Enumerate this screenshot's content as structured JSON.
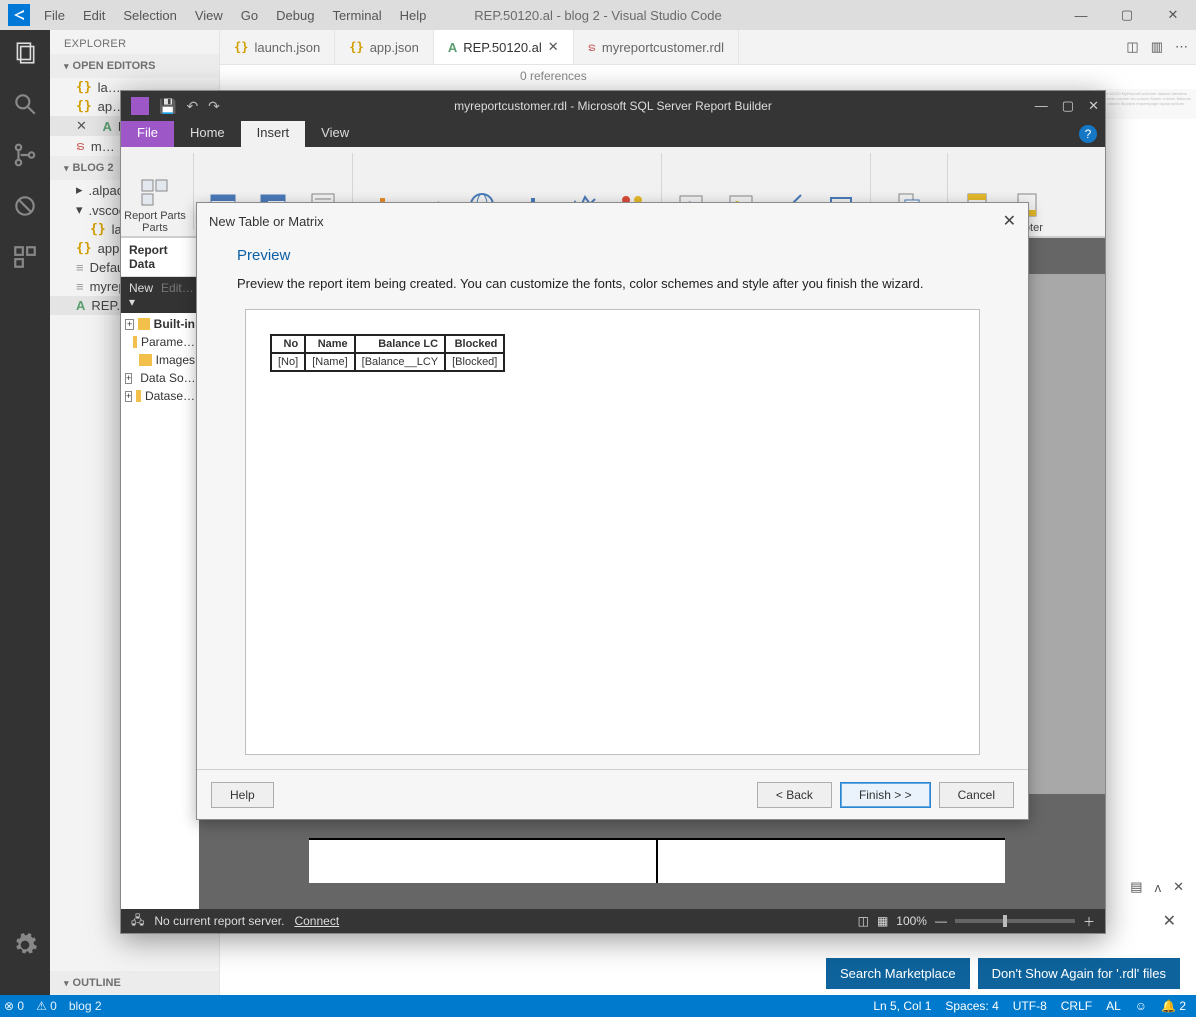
{
  "vscode": {
    "menus": [
      "File",
      "Edit",
      "Selection",
      "View",
      "Go",
      "Debug",
      "Terminal",
      "Help"
    ],
    "window_title": "REP.50120.al - blog 2 - Visual Studio Code",
    "window_controls": {
      "min": "—",
      "max": "▢",
      "close": "✕"
    },
    "explorer_label": "EXPLORER",
    "open_editors_label": "OPEN EDITORS",
    "folder_label": "BLOG 2",
    "outline_label": "OUTLINE",
    "open_editors": [
      {
        "icon": "brace",
        "name": "la…"
      },
      {
        "icon": "brace",
        "name": "ap…"
      },
      {
        "icon": "al",
        "name": "R…"
      },
      {
        "icon": "feed",
        "name": "m…"
      }
    ],
    "folder_tree": [
      {
        "chev": "▸",
        "name": ".alpac…"
      },
      {
        "chev": "▾",
        "name": ".vscod…"
      },
      {
        "icon": "brace",
        "name": "laun…"
      },
      {
        "icon": "brace",
        "name": "app.js…"
      },
      {
        "icon": "doc",
        "name": "Defau…"
      },
      {
        "icon": "doc",
        "name": "myrep…"
      },
      {
        "icon": "al",
        "name": "REP.5…"
      }
    ],
    "tabs": [
      {
        "icon": "brace",
        "label": "launch.json",
        "active": false,
        "close": false
      },
      {
        "icon": "brace",
        "label": "app.json",
        "active": false,
        "close": false
      },
      {
        "icon": "al",
        "label": "REP.50120.al",
        "active": true,
        "close": true
      },
      {
        "icon": "feed",
        "label": "myreportcustomer.rdl",
        "active": false,
        "close": false
      }
    ],
    "breadcrumb": "0 references",
    "toast": {
      "btn1": "Search Marketplace",
      "btn2": "Don't Show Again for '.rdl' files"
    },
    "statusbar": {
      "errors": "⊗ 0",
      "warnings": "⚠ 0",
      "branch": "blog 2",
      "ln": "Ln 5, Col 1",
      "spaces": "Spaces: 4",
      "enc": "UTF-8",
      "eol": "CRLF",
      "lang": "AL",
      "smile": "☺",
      "bell": "🔔 2"
    }
  },
  "report_builder": {
    "title": "myreportcustomer.rdl - Microsoft SQL Server Report Builder",
    "tabs": {
      "file": "File",
      "home": "Home",
      "insert": "Insert",
      "view": "View"
    },
    "ribbon": [
      {
        "label": "Report Parts",
        "sub": "Parts",
        "group": "parts"
      },
      {
        "label": "Table",
        "group": "data"
      },
      {
        "label": "Matrix",
        "group": "data"
      },
      {
        "label": "List",
        "group": "data"
      },
      {
        "label": "Chart",
        "group": "viz"
      },
      {
        "label": "Gauge",
        "group": "viz"
      },
      {
        "label": "Map",
        "group": "viz"
      },
      {
        "label": "Data",
        "group": "viz"
      },
      {
        "label": "Sparkline",
        "group": "viz"
      },
      {
        "label": "Indicator",
        "group": "viz"
      },
      {
        "label": "Text",
        "group": "items"
      },
      {
        "label": "Image",
        "group": "items"
      },
      {
        "label": "Line",
        "group": "items"
      },
      {
        "label": "Rectangle",
        "group": "items"
      },
      {
        "label": "Subreport",
        "group": "sub"
      },
      {
        "label": "Header",
        "group": "hf"
      },
      {
        "label": "Footer",
        "group": "hf"
      }
    ],
    "report_data": {
      "header": "Report Data",
      "new": "New",
      "edit": "Edit…",
      "nodes": [
        "Built-in",
        "Parame…",
        "Images",
        "Data So…",
        "Datase…"
      ]
    },
    "statusbar": {
      "msg": "No current report server.",
      "connect": "Connect",
      "zoom": "100%"
    }
  },
  "wizard": {
    "title": "New Table or Matrix",
    "heading": "Preview",
    "desc": "Preview the report item being created. You can customize the fonts, color schemes and style after you finish the wizard.",
    "columns": [
      "No",
      "Name",
      "Balance LC",
      "Blocked"
    ],
    "row": [
      "[No]",
      "[Name]",
      "[Balance__LCY",
      "[Blocked]"
    ],
    "buttons": {
      "help": "Help",
      "back": "<  Back",
      "finish": "Finish > >",
      "cancel": "Cancel"
    }
  }
}
